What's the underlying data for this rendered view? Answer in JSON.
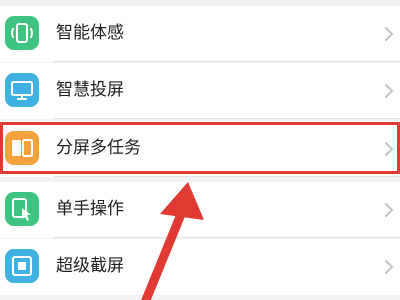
{
  "settings_list": {
    "items": [
      {
        "label": "智能体感",
        "icon": "smart-motion-icon",
        "icon_color": "#3cc480"
      },
      {
        "label": "智慧投屏",
        "icon": "screen-projection-icon",
        "icon_color": "#3fb1e3"
      },
      {
        "label": "分屏多任务",
        "icon": "split-screen-icon",
        "icon_color": "#f4a23b"
      },
      {
        "label": "单手操作",
        "icon": "one-handed-icon",
        "icon_color": "#3cc480"
      },
      {
        "label": "超级截屏",
        "icon": "super-screenshot-icon",
        "icon_color": "#3fb1e3"
      }
    ]
  },
  "annotation": {
    "highlight_color": "#e03a32",
    "highlighted_item": "分屏多任务"
  }
}
